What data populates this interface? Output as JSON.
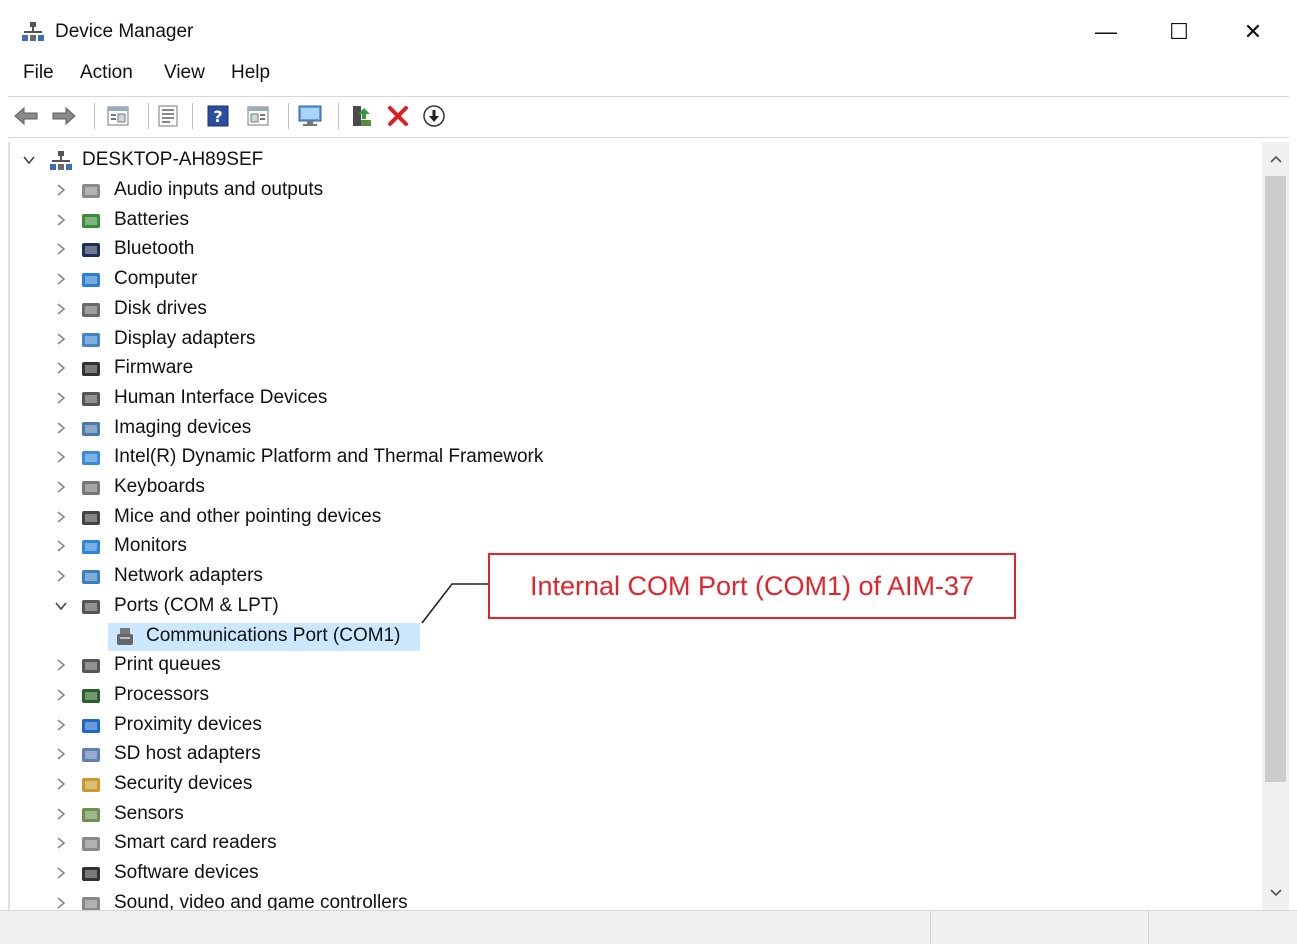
{
  "window": {
    "title": "Device Manager",
    "icon": "device-manager-icon",
    "controls": {
      "minimize": "—",
      "maximize": "☐",
      "close": "✕"
    }
  },
  "menu": [
    "File",
    "Action",
    "View",
    "Help"
  ],
  "toolbar": [
    "back-arrow-icon",
    "forward-arrow-icon",
    "show-hide-console-tree-icon",
    "properties-icon",
    "help-icon",
    "action-pane-icon",
    "scan-hardware-icon",
    "update-driver-icon",
    "uninstall-icon",
    "disable-device-icon"
  ],
  "tree": {
    "root": "DESKTOP-AH89SEF",
    "categories": [
      "Audio inputs and outputs",
      "Batteries",
      "Bluetooth",
      "Computer",
      "Disk drives",
      "Display adapters",
      "Firmware",
      "Human Interface Devices",
      "Imaging devices",
      "Intel(R) Dynamic Platform and Thermal Framework",
      "Keyboards",
      "Mice and other pointing devices",
      "Monitors",
      "Network adapters",
      "Ports (COM & LPT)",
      "Print queues",
      "Processors",
      "Proximity devices",
      "SD host adapters",
      "Security devices",
      "Sensors",
      "Smart card readers",
      "Software devices",
      "Sound, video and game controllers"
    ],
    "expanded_child": "Communications Port (COM1)"
  },
  "annotation": {
    "text": "Internal COM Port (COM1) of AIM-37",
    "color": "#e3242b"
  },
  "colors": {
    "selection": "#cce8ff",
    "accent": "#e3242b"
  }
}
